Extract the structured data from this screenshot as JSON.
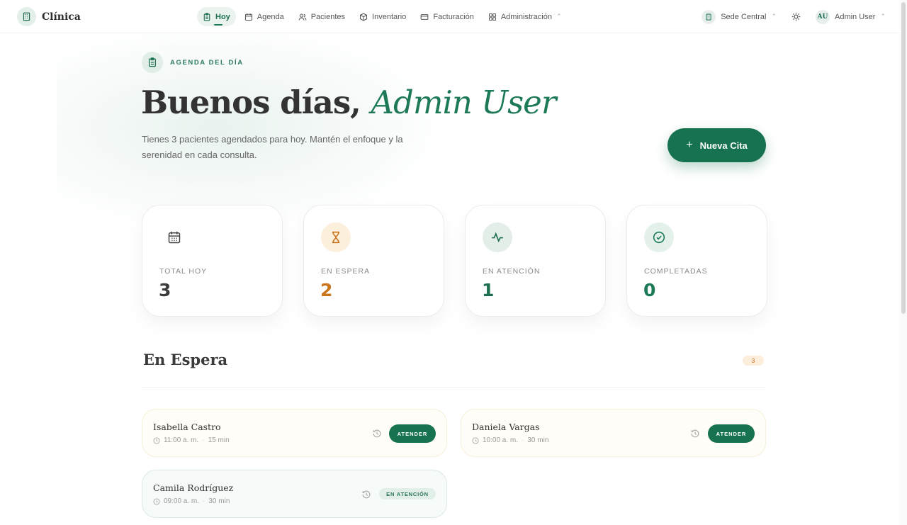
{
  "brand": {
    "name": "Clínica"
  },
  "nav": {
    "items": [
      {
        "label": "Hoy",
        "icon": "clipboard-icon",
        "active": true
      },
      {
        "label": "Agenda",
        "icon": "calendar-icon"
      },
      {
        "label": "Pacientes",
        "icon": "users-icon"
      },
      {
        "label": "Inventario",
        "icon": "box-icon"
      },
      {
        "label": "Facturación",
        "icon": "credit-card-icon"
      },
      {
        "label": "Administración",
        "icon": "grid-icon"
      }
    ],
    "location": "Sede Central",
    "user_initials": "AU",
    "user_name": "Admin User"
  },
  "hero": {
    "eyebrow": "AGENDA DEL DÍA",
    "greeting": "Buenos días,",
    "name": "Admin User",
    "subtitle": "Tienes 3 pacientes agendados para hoy. Mantén el enfoque y la serenidad en cada consulta.",
    "cta": "Nueva Cita",
    "cta_icon": "plus-icon"
  },
  "stats": [
    {
      "label": "TOTAL HOY",
      "value": "3",
      "icon": "calendar-icon",
      "color": "#3a3a3a"
    },
    {
      "label": "EN ESPERA",
      "value": "2",
      "icon": "hourglass-icon",
      "color": "#c9741b"
    },
    {
      "label": "EN ATENCIÓN",
      "value": "1",
      "icon": "activity-icon",
      "color": "#1d6f4f"
    },
    {
      "label": "COMPLETADAS",
      "value": "0",
      "icon": "check-circle-icon",
      "color": "#1d7a56"
    }
  ],
  "section": {
    "title": "En Espera",
    "count": "3"
  },
  "appointments": [
    {
      "name": "Isabella Castro",
      "time": "11:00 a. m.",
      "duration": "15 min",
      "action": "ATENDER"
    },
    {
      "name": "Daniela Vargas",
      "time": "10:00 a. m.",
      "duration": "30 min",
      "action": "ATENDER"
    },
    {
      "name": "Camila Rodríguez",
      "time": "09:00 a. m.",
      "duration": "30 min",
      "status": "EN ATENCIÓN"
    }
  ],
  "colors": {
    "accent": "#17724f",
    "warning": "#c9741b"
  }
}
